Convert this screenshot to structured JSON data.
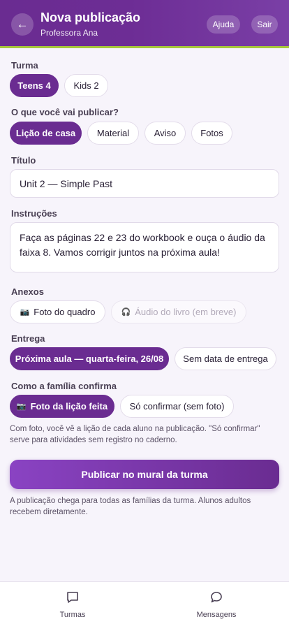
{
  "header": {
    "back_icon": "arrow-left-icon",
    "title": "Nova publicação",
    "subtitle": "Professora Ana",
    "help_label": "Ajuda",
    "exit_label": "Sair"
  },
  "class_section": {
    "label": "Turma",
    "options": [
      {
        "label": "Teens 4",
        "selected": true
      },
      {
        "label": "Kids 2",
        "selected": false
      }
    ]
  },
  "type_section": {
    "label": "O que você vai publicar?",
    "options": [
      {
        "label": "Lição de casa",
        "selected": true
      },
      {
        "label": "Material",
        "selected": false
      },
      {
        "label": "Aviso",
        "selected": false
      },
      {
        "label": "Fotos",
        "selected": false
      }
    ]
  },
  "title_section": {
    "label": "Título",
    "value": "Unit 2 — Simple Past"
  },
  "instructions_section": {
    "label": "Instruções",
    "value": "Faça as páginas 22 e 23 do workbook e ouça o áudio da faixa 8. Vamos corrigir juntos na próxima aula!"
  },
  "attachments_section": {
    "label": "Anexos",
    "options": [
      {
        "label": "Foto do quadro",
        "icon": "camera-icon",
        "enabled": true
      },
      {
        "label": "Áudio do livro (em breve)",
        "icon": "headphones-icon",
        "enabled": false
      }
    ]
  },
  "delivery_section": {
    "label": "Entrega",
    "options": [
      {
        "label": "Próxima aula — quarta-feira, 26/08",
        "selected": true
      },
      {
        "label": "Sem data de entrega",
        "selected": false
      }
    ]
  },
  "confirm_section": {
    "label": "Como a família confirma",
    "options": [
      {
        "label": "Foto da lição feita",
        "icon": "camera-icon",
        "selected": true
      },
      {
        "label": "Só confirmar (sem foto)",
        "selected": false
      }
    ],
    "note": "Com foto, você vê a lição de cada aluno na publicação. \"Só confirmar\" serve para atividades sem registro no caderno."
  },
  "publish": {
    "label": "Publicar no mural da turma",
    "note": "A publicação chega para todas as famílias da turma. Alunos adultos recebem diretamente."
  },
  "tabbar": {
    "items": [
      {
        "label": "Turmas",
        "icon": "chat-square-icon"
      },
      {
        "label": "Mensagens",
        "icon": "chat-bubble-icon"
      }
    ]
  },
  "colors": {
    "primary": "#6a2c91",
    "accent_line": "#a7c93b",
    "background": "#f7f4fb"
  }
}
